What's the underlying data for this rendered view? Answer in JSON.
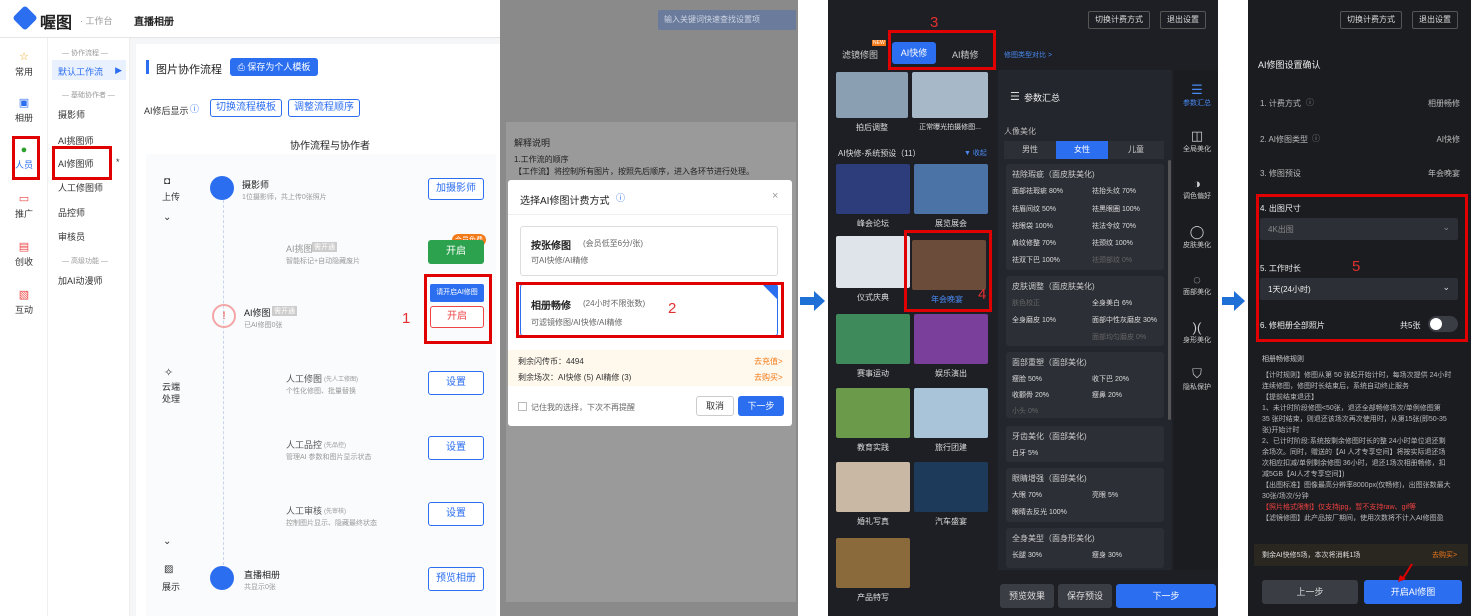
{
  "panel1": {
    "logo": "喔图",
    "workspace": "· 工作台",
    "page_title": "直播相册",
    "left_nav": [
      "常用",
      "相册",
      "人员",
      "推广",
      "创收",
      "互动"
    ],
    "sub_nav": {
      "group1": "— 协作流程 —",
      "default_flow": "默认工作流",
      "group2": "— 基础协作者 —",
      "items": [
        "摄影师",
        "AI挑图师",
        "AI修图师",
        "人工修图师",
        "品控师",
        "审核员"
      ],
      "group3": "— 高级功能 —",
      "extra": "加AI动漫师"
    },
    "section_title": "图片协作流程",
    "save_template": "保存为个人模板",
    "ai_display_label": "AI修后显示",
    "switch_template": "切换流程模板",
    "adjust_order": "调整流程顺序",
    "flow_header": "协作流程与协作者",
    "stages": {
      "upload": "上传",
      "cloud": "云端",
      "process": "处理",
      "display": "展示"
    },
    "nodes": [
      {
        "title": "摄影师",
        "sub": "1位摄影师，共上传0张照片",
        "button": "加摄影师"
      },
      {
        "title": "AI挑图",
        "tag": "需开通",
        "sub": "智能标记+自动隐藏废片",
        "badge": "会员免费",
        "button": "开启"
      },
      {
        "title": "AI修图",
        "tag": "需开通",
        "sub": "已AI修图0张",
        "tooltip": "请开启AI修图",
        "button": "开启"
      },
      {
        "title": "人工修图",
        "tag": "(先人工修图)",
        "sub": "个性化修图、批量替换",
        "button": "设置"
      },
      {
        "title": "人工品控",
        "tag": "(先品控)",
        "sub": "管理AI 参数和图片显示状态",
        "button": "设置"
      },
      {
        "title": "人工审核",
        "tag": "(先审核)",
        "sub": "控制图片显示、隐藏最终状态",
        "button": "设置"
      },
      {
        "title": "直播相册",
        "sub": "共显示0张",
        "button": "预览相册"
      }
    ],
    "step_num": "1"
  },
  "panel2": {
    "search_placeholder": "输入关键词快速查找设置项",
    "explain_title": "解释说明",
    "explain_line1": "1.工作流的顺序",
    "explain_line2": "【工作流】将控制所有图片，按照先后顺序，进入各环节进行处理。",
    "dialog_title": "选择AI修图计费方式",
    "opt1_title": "按张修图",
    "opt1_note": "(会员低至6分/张)",
    "opt1_desc": "可AI快修/AI精修",
    "opt2_title": "相册畅修",
    "opt2_note": "(24小时不限张数)",
    "opt2_desc": "可滤镜修图/AI快修/AI精修",
    "remain_coins": "剩余闪传币：4494",
    "recharge": "去充值>",
    "remain_sessions": "剩余场次：AI快修 (5) AI精修 (3)",
    "buy": "去购买>",
    "remember": "记住我的选择，下次不再提醒",
    "cancel": "取消",
    "next": "下一步",
    "step_num": "2"
  },
  "panel3": {
    "top_btn1": "切换计费方式",
    "top_btn2": "退出设置",
    "tabs": [
      "滤镜修图",
      "AI快修",
      "AI精修"
    ],
    "tab_badge": "NEW",
    "compare_link": "修图类型对比 >",
    "top_captions": [
      "拍后调整",
      "正常曝光拍摄修图..."
    ],
    "preset_header": "AI快修-系统预设（11）",
    "collapse": "▼ 收起",
    "presets": [
      "峰会论坛",
      "展览展会",
      "仪式庆典",
      "年会晚宴",
      "赛事运动",
      "娱乐演出",
      "教育实践",
      "旅行团建",
      "婚礼写真",
      "汽车盛宴",
      "产品特写"
    ],
    "param_title": "参数汇总",
    "beauty_label": "人像美化",
    "genders": [
      "男性",
      "女性",
      "儿童"
    ],
    "cards": [
      {
        "title": "祛除瑕疵（面皮肤美化)",
        "items": [
          "面部祛瑕疵 80%",
          "祛抬头纹 70%",
          "祛眉间纹 50%",
          "祛黑眼圈 100%",
          "祛眼袋 100%",
          "祛法令纹 70%",
          "肩纹修整 70%",
          "祛颈纹 100%",
          "祛双下巴 100%",
          "祛颈部纹 0%"
        ]
      },
      {
        "title": "皮肤调整（面皮肤美化)",
        "items": [
          "肤色校正",
          "全身美白 6%",
          "全身磨皮 10%",
          "面部中性灰磨皮 30%",
          "",
          "面部均匀磨皮 0%"
        ]
      },
      {
        "title": "面部重塑（面部美化)",
        "items": [
          "瘦脸 50%",
          "收下巴 20%",
          "收颧骨 20%",
          "瘦鼻 20%",
          "小头 0%"
        ]
      },
      {
        "title": "牙齿美化（面部美化)",
        "items": [
          "白牙 5%"
        ]
      },
      {
        "title": "眼睛增强（面部美化)",
        "items": [
          "大眼 70%",
          "亮眼 5%",
          "眼睛去反光 100%"
        ]
      },
      {
        "title": "全身美型（面身形美化)",
        "items": [
          "长腿 30%",
          "瘦身 30%"
        ]
      }
    ],
    "tools": [
      "参数汇总",
      "全局美化",
      "调色偏好",
      "皮肤美化",
      "面部美化",
      "身形美化",
      "隐私保护"
    ],
    "btn_preview": "预览效果",
    "btn_save": "保存预设",
    "btn_next": "下一步",
    "step3": "3",
    "step4": "4"
  },
  "panel4": {
    "top_btn1": "切换计费方式",
    "top_btn2": "退出设置",
    "title": "AI修图设置确认",
    "rows": [
      {
        "label": "1. 计费方式",
        "value": "相册畅修"
      },
      {
        "label": "2. AI修图类型",
        "value": "AI快修"
      },
      {
        "label": "3. 修图预设",
        "value": "年会晚宴"
      }
    ],
    "size_label": "4. 出图尺寸",
    "size_value": "4K出图",
    "time_label": "5. 工作时长",
    "time_value": "1天(24小时)",
    "all_label": "6. 修相册全部照片",
    "all_value": "共5张",
    "rule_title": "相册畅修规则",
    "rules": [
      "【计时规则】修图从第 50 张起开始计时，每场次提供 24小时",
      "连续修图，修图时长结束后，系统自动终止服务",
      "【提前结束退还】",
      "1、未计时阶段修图<50张，退还全部畅修场次/单例修图第",
      "35 张时结束，则退还该场次再次使用时，从第15张(即50-35",
      "张)开始计时",
      "2、已计时阶段:系统按剩余修图时长的整 24小时单位退还剩",
      "余场次。同时，赠送的【AI 人才专享空间】将按实际退还场",
      "次相应扣减/单例剩余修图 36小时，退还1场次相册畅修，扣",
      "减5GB【AI人才专享空间】)",
      "【出图标准】图像最高分辨率8000px(仅畅修)，出图张数最大",
      "30张/场次/分钟",
      "【照片格式限制】仅支持jpg，暂不支持raw、gif等",
      "【滤镜修图】此产品按厂期间，使用次数将不计入AI修图盈"
    ],
    "remain": "剩余AI快修5场，本次将消耗1场",
    "buy": "去购买>",
    "prev": "上一步",
    "start": "开启AI修图",
    "step5": "5"
  }
}
